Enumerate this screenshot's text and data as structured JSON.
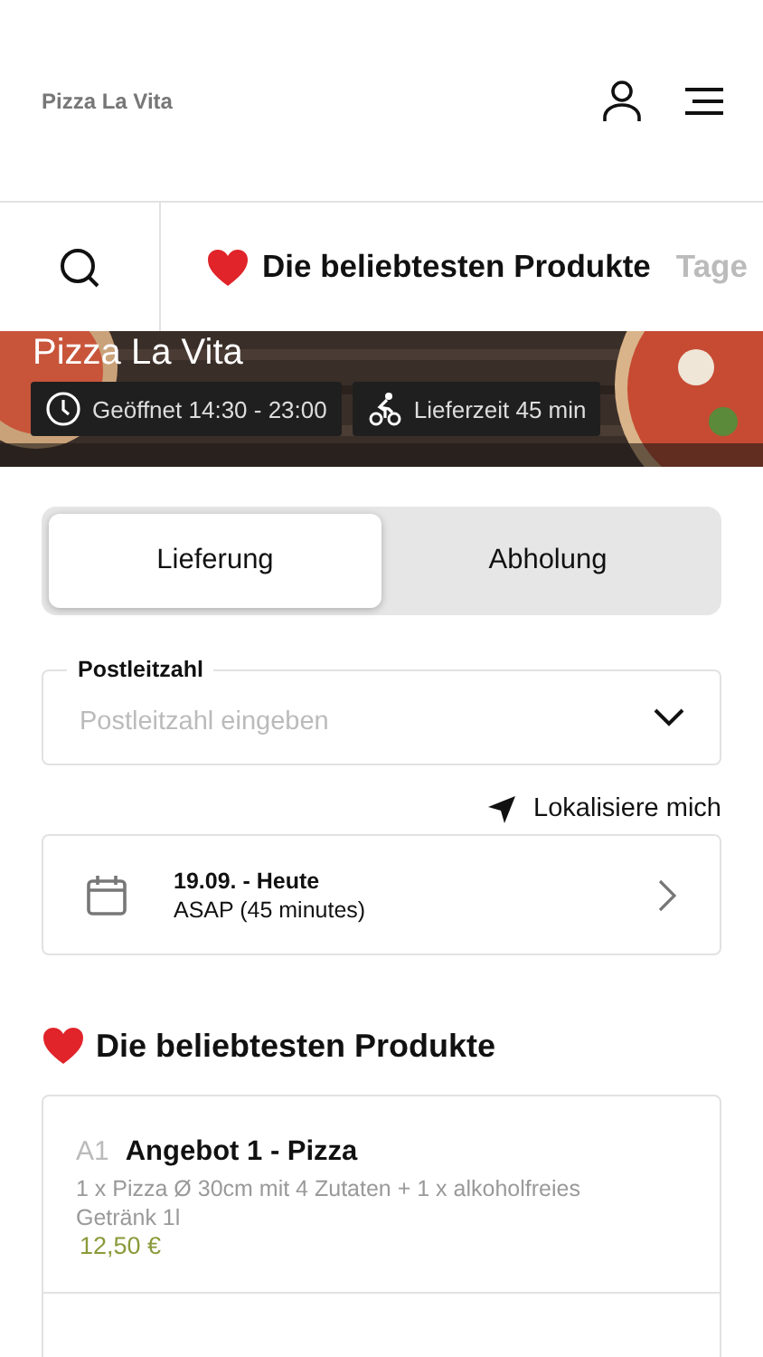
{
  "header": {
    "logo": "Pizza La Vita"
  },
  "category_tabs": [
    {
      "label": "Die beliebtesten Produkte",
      "selected": true,
      "kind": "heart"
    },
    {
      "label": "Tage",
      "selected": false,
      "kind": "plain"
    }
  ],
  "hero": {
    "kind": "picture",
    "title": "Pizza La Vita",
    "badges": [
      {
        "kind": "clock",
        "text": "Geöffnet 14:30 - 23:00"
      },
      {
        "kind": "bike",
        "text": "Lieferzeit 45 min"
      }
    ]
  },
  "order_mode": [
    {
      "label": "Lieferung",
      "selected": true
    },
    {
      "label": "Abholung",
      "selected": false
    }
  ],
  "postcode": {
    "label": "Postleitzahl",
    "placeholder": "Postleitzahl eingeben"
  },
  "locate": "Lokalisiere mich",
  "schedule": {
    "date": "19.09. - Heute",
    "time": "ASAP (45 minutes)"
  },
  "section_title": "Die beliebtesten Produkte",
  "products": [
    {
      "code": "A1",
      "name": "Angebot 1 - Pizza",
      "description": "1 x Pizza Ø 30cm mit 4 Zutaten + 1 x alkoholfreies Getränk 1l",
      "price": "12,50 €"
    }
  ]
}
